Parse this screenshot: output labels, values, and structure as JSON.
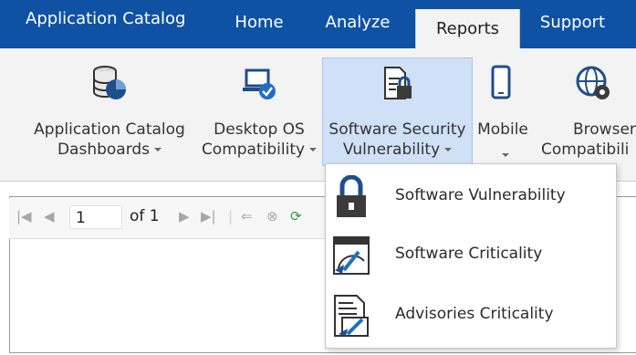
{
  "tabs": {
    "app_title": "Application Catalog",
    "home": "Home",
    "analyze": "Analyze",
    "reports": "Reports",
    "support": "Support"
  },
  "ribbon": {
    "items": [
      {
        "line1": "Application Catalog",
        "line2": "Dashboards",
        "icon": "database-pie-icon"
      },
      {
        "line1": "Desktop OS",
        "line2": "Compatibility",
        "icon": "laptop-check-icon"
      },
      {
        "line1": "Software Security",
        "line2": "Vulnerability",
        "icon": "document-lock-icon"
      },
      {
        "line1": "Mobile",
        "line2": "",
        "icon": "mobile-phone-icon"
      },
      {
        "line1": "Browser",
        "line2": "Compatibili",
        "icon": "globe-gear-icon"
      }
    ]
  },
  "viewer": {
    "page_value": "1",
    "of_label": "of 1"
  },
  "menu": {
    "items": [
      {
        "label": "Software Vulnerability",
        "icon": "padlock-icon"
      },
      {
        "label": "Software Criticality",
        "icon": "gauge-browser-icon"
      },
      {
        "label": "Advisories Criticality",
        "icon": "document-gauge-icon"
      }
    ]
  },
  "colors": {
    "tab_bar": "#0f52a4",
    "ribbon_bg": "#f3f3f3",
    "active_button": "#cfe0f7"
  }
}
